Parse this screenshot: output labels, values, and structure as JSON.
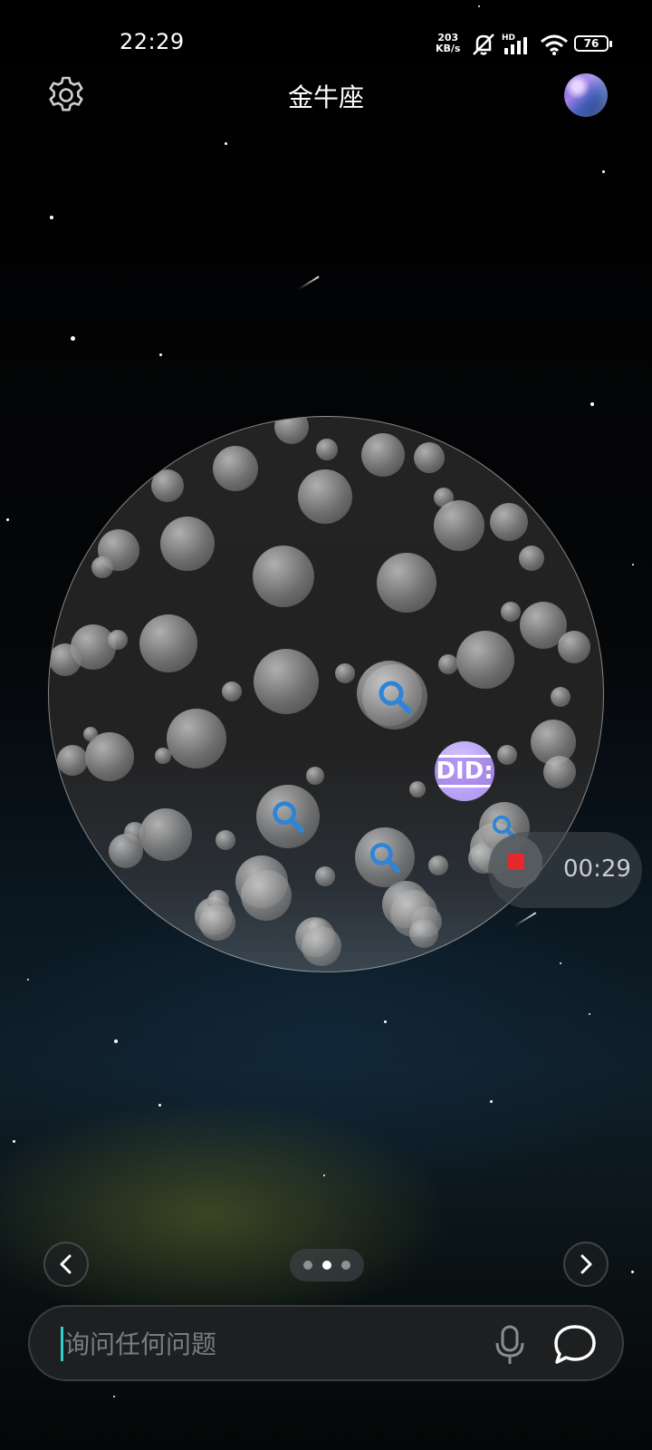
{
  "status_bar": {
    "time": "22:29",
    "net_speed_value": "203",
    "net_speed_unit": "KB/s",
    "hd_label": "HD",
    "battery": "76"
  },
  "header": {
    "title": "金牛座"
  },
  "recording": {
    "elapsed": "00:29"
  },
  "did_badge": {
    "label": "DID:"
  },
  "pager": {
    "count": 3,
    "active_index": 1
  },
  "input": {
    "placeholder": "询问任何问题"
  },
  "colors": {
    "accent_caret": "#2fd2c8",
    "tool_icon_blue": "#2e84d6",
    "record_red": "#e5282e",
    "did_purple": "#b49cf4"
  }
}
